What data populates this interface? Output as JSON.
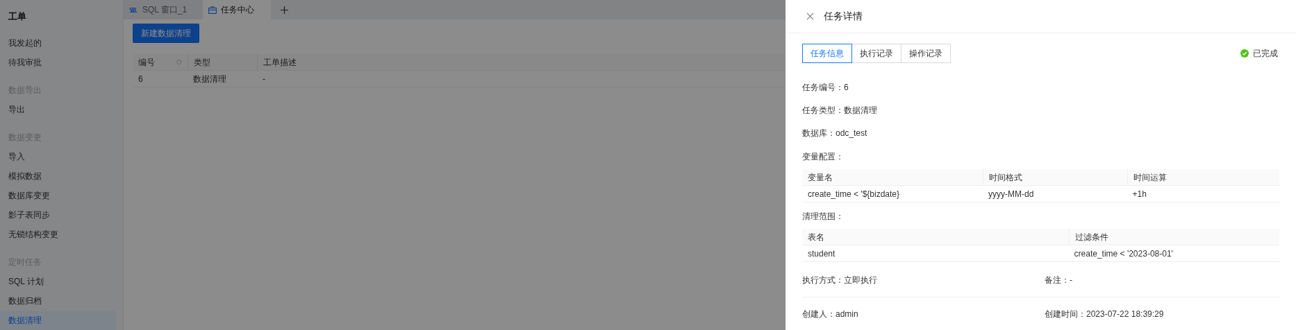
{
  "sidebar": {
    "title": "工单",
    "sections": [
      {
        "items": [
          {
            "label": "我发起的",
            "selected": false
          },
          {
            "label": "待我审批",
            "selected": false
          }
        ]
      },
      {
        "heading": "数据导出",
        "items": [
          {
            "label": "导出",
            "selected": false
          }
        ]
      },
      {
        "heading": "数据变更",
        "items": [
          {
            "label": "导入",
            "selected": false
          },
          {
            "label": "模拟数据",
            "selected": false
          },
          {
            "label": "数据库变更",
            "selected": false
          },
          {
            "label": "影子表同步",
            "selected": false
          },
          {
            "label": "无锁结构变更",
            "selected": false
          }
        ]
      },
      {
        "heading": "定时任务",
        "items": [
          {
            "label": "SQL 计划",
            "selected": false
          },
          {
            "label": "数据归档",
            "selected": false
          },
          {
            "label": "数据清理",
            "selected": true
          }
        ]
      }
    ]
  },
  "tabs": [
    {
      "kind": "sql",
      "label": "SQL 窗口_1",
      "selected": false
    },
    {
      "kind": "task",
      "label": "任务中心",
      "selected": true
    }
  ],
  "new_button": "新建数据清理",
  "table": {
    "columns": [
      "编号",
      "类型",
      "工单描述"
    ],
    "rows": [
      [
        "6",
        "数据清理",
        "-"
      ]
    ]
  },
  "drawer": {
    "title": "任务详情",
    "tabs": [
      {
        "label": "任务信息",
        "selected": true
      },
      {
        "label": "执行记录",
        "selected": false
      },
      {
        "label": "操作记录",
        "selected": false
      }
    ],
    "status": "已完成",
    "details": [
      {
        "kind": "field",
        "label": "任务编号：",
        "value": "6"
      },
      {
        "kind": "field",
        "label": "任务类型：",
        "value": "数据清理"
      },
      {
        "kind": "field",
        "label": "数据库：",
        "value": "odc_test"
      },
      {
        "kind": "heading",
        "label": "变量配置："
      },
      {
        "kind": "table",
        "columns": [
          "变量名",
          "时间格式",
          "时间运算"
        ],
        "rows": [
          [
            "create_time < '${bizdate}",
            "yyyy-MM-dd",
            "+1h"
          ]
        ]
      },
      {
        "kind": "heading",
        "label": "清理范围："
      },
      {
        "kind": "table",
        "columns": [
          "表名",
          "过滤条件"
        ],
        "rows": [
          [
            "student",
            "create_time < '2023-08-01'"
          ]
        ]
      },
      {
        "kind": "pair",
        "items": [
          {
            "label": "执行方式：",
            "value": "立即执行"
          },
          {
            "label": "备注：",
            "value": "-"
          }
        ]
      },
      {
        "kind": "pair",
        "items": [
          {
            "label": "创建人：",
            "value": "admin"
          },
          {
            "label": "创建时间：",
            "value": "2023-07-22 18:39:29"
          }
        ]
      }
    ]
  }
}
